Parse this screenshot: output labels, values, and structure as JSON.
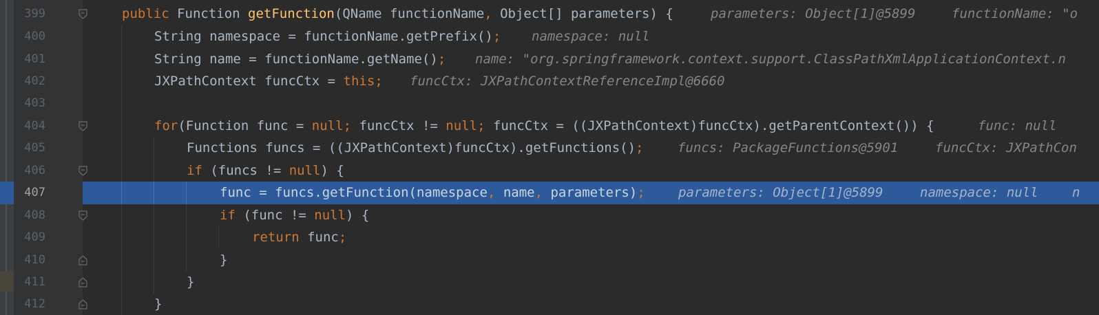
{
  "editor": {
    "lines": [
      {
        "number": "399",
        "kw1": "public ",
        "type1": "Function ",
        "method": "getFunction",
        "open": "(QName functionName",
        "comma": ",",
        "rest": " Object[] parameters) {",
        "hint1": "parameters: Object[1]@5899",
        "hint2": "functionName: \"o"
      },
      {
        "number": "400",
        "code": "String namespace = functionName.getPrefix()",
        "semi": ";",
        "hint1": "namespace: null"
      },
      {
        "number": "401",
        "code": "String name = functionName.getName()",
        "semi": ";",
        "hint1": "name: \"org.springframework.context.support.ClassPathXmlApplicationContext.n"
      },
      {
        "number": "402",
        "code": "JXPathContext funcCtx = ",
        "kw": "this",
        "semi": ";",
        "hint1": "funcCtx: JXPathContextReferenceImpl@6660"
      },
      {
        "number": "403"
      },
      {
        "number": "404",
        "kw1": "for",
        "c1": "(Function func = ",
        "kw2": "null",
        "semi1": ";",
        "c2": " funcCtx != ",
        "kw3": "null",
        "semi2": ";",
        "c3": " funcCtx = ((JXPathContext)funcCtx).getParentContext()) {",
        "hint1": "func: null"
      },
      {
        "number": "405",
        "code": "Functions funcs = ((JXPathContext)funcCtx).getFunctions()",
        "semi": ";",
        "hint1": "funcs: PackageFunctions@5901",
        "hint2": "funcCtx: JXPathCon"
      },
      {
        "number": "406",
        "kw1": "if",
        "c1": " (funcs != ",
        "kw2": "null",
        "c2": ") {"
      },
      {
        "number": "407",
        "c1": "func = funcs.getFunction(namespace",
        "comma1": ",",
        "c2": " name",
        "comma2": ",",
        "c3": " parameters)",
        "semi": ";",
        "hint1": "parameters: Object[1]@5899",
        "hint2": "namespace: null",
        "hint3": "n"
      },
      {
        "number": "408",
        "kw1": "if",
        "c1": " (func != ",
        "kw2": "null",
        "c2": ") {"
      },
      {
        "number": "409",
        "kw1": "return",
        "c1": " func",
        "semi": ";"
      },
      {
        "number": "410",
        "code": "}"
      },
      {
        "number": "411",
        "code": "}"
      },
      {
        "number": "412",
        "code": "}"
      }
    ],
    "colors": {
      "background": "#2b2b2b",
      "gutter": "#313335",
      "current_line": "#2d5a9a",
      "keyword": "#cc7832",
      "method": "#ffc66d",
      "text": "#a9b7c6",
      "inline_hint": "#858585",
      "line_number": "#606366"
    },
    "icons": {
      "fold_open": "fold-collapse-icon",
      "fold_close": "fold-end-icon"
    }
  }
}
